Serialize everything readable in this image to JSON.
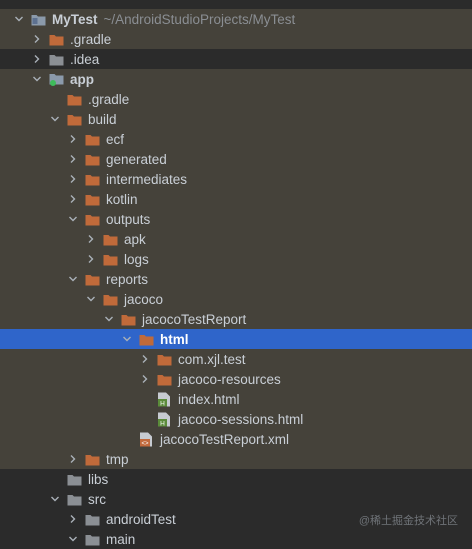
{
  "project_tree": {
    "items": [
      {
        "label": "MyTest",
        "hint": "~/AndroidStudioProjects/MyTest",
        "depth": 0,
        "expand": "down",
        "icon": "project-icon",
        "hl": true,
        "bold": true
      },
      {
        "label": ".gradle",
        "depth": 1,
        "expand": "right",
        "icon": "folder-icon",
        "hl": true
      },
      {
        "label": ".idea",
        "depth": 1,
        "expand": "right",
        "icon": "folder-icon",
        "hl": false
      },
      {
        "label": "app",
        "depth": 1,
        "expand": "down",
        "icon": "module-icon",
        "hl": true,
        "bold": true
      },
      {
        "label": ".gradle",
        "depth": 2,
        "expand": "none",
        "icon": "folder-icon",
        "hl": true
      },
      {
        "label": "build",
        "depth": 2,
        "expand": "down",
        "icon": "folder-icon",
        "hl": true
      },
      {
        "label": "ecf",
        "depth": 3,
        "expand": "right",
        "icon": "folder-icon",
        "hl": true
      },
      {
        "label": "generated",
        "depth": 3,
        "expand": "right",
        "icon": "folder-icon",
        "hl": true
      },
      {
        "label": "intermediates",
        "depth": 3,
        "expand": "right",
        "icon": "folder-icon",
        "hl": true
      },
      {
        "label": "kotlin",
        "depth": 3,
        "expand": "right",
        "icon": "folder-icon",
        "hl": true
      },
      {
        "label": "outputs",
        "depth": 3,
        "expand": "down",
        "icon": "folder-icon",
        "hl": true
      },
      {
        "label": "apk",
        "depth": 4,
        "expand": "right",
        "icon": "folder-icon",
        "hl": true
      },
      {
        "label": "logs",
        "depth": 4,
        "expand": "right",
        "icon": "folder-icon",
        "hl": true
      },
      {
        "label": "reports",
        "depth": 3,
        "expand": "down",
        "icon": "folder-icon",
        "hl": true
      },
      {
        "label": "jacoco",
        "depth": 4,
        "expand": "down",
        "icon": "folder-icon",
        "hl": true
      },
      {
        "label": "jacocoTestReport",
        "depth": 5,
        "expand": "down",
        "icon": "folder-icon",
        "hl": true
      },
      {
        "label": "html",
        "depth": 6,
        "expand": "down",
        "icon": "folder-icon",
        "selected": true,
        "bold": true
      },
      {
        "label": "com.xjl.test",
        "depth": 7,
        "expand": "right",
        "icon": "folder-icon",
        "hl": true
      },
      {
        "label": "jacoco-resources",
        "depth": 7,
        "expand": "right",
        "icon": "folder-icon",
        "hl": true
      },
      {
        "label": "index.html",
        "depth": 7,
        "expand": "none",
        "icon": "html-file-icon",
        "hl": true
      },
      {
        "label": "jacoco-sessions.html",
        "depth": 7,
        "expand": "none",
        "icon": "html-file-icon",
        "hl": true
      },
      {
        "label": "jacocoTestReport.xml",
        "depth": 6,
        "expand": "none",
        "icon": "xml-file-icon",
        "hl": true
      },
      {
        "label": "tmp",
        "depth": 3,
        "expand": "right",
        "icon": "folder-icon",
        "hl": true
      },
      {
        "label": "libs",
        "depth": 2,
        "expand": "none",
        "icon": "folder-icon",
        "hl": false
      },
      {
        "label": "src",
        "depth": 2,
        "expand": "down",
        "icon": "folder-icon",
        "hl": false
      },
      {
        "label": "androidTest",
        "depth": 3,
        "expand": "right",
        "icon": "folder-icon",
        "hl": false
      },
      {
        "label": "main",
        "depth": 3,
        "expand": "down",
        "icon": "folder-icon",
        "hl": false
      }
    ]
  },
  "watermark": "@稀土掘金技术社区",
  "colors": {
    "background": "#2b2b2b",
    "excluded_highlight": "#45423a",
    "selection": "#2f65ca",
    "text": "#c9cfd6",
    "folder_orange": "#c06a3a",
    "folder_gray": "#8b8f94",
    "html_green": "#5b8c3a",
    "xml_orange": "#c26a3c"
  }
}
